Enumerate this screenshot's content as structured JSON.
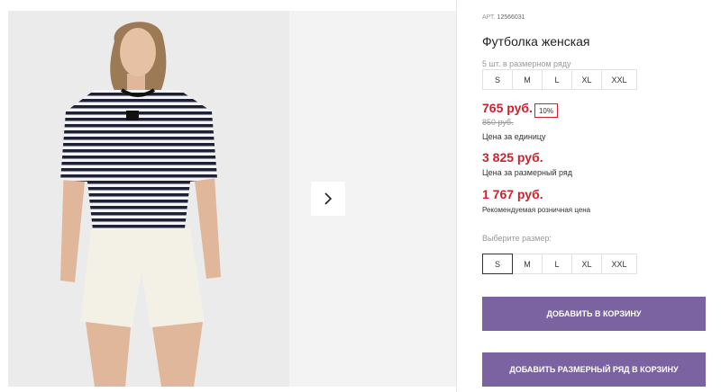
{
  "product": {
    "article_label": "АРТ.",
    "article_code": "12566031",
    "title": "Футболка женская",
    "pack_label": "5 шт. в размерном ряду",
    "pack_sizes": [
      "S",
      "M",
      "L",
      "XL",
      "XXL"
    ],
    "price": "765 руб.",
    "discount": "10%",
    "old_price": "850 руб.",
    "price_per_unit_label": "Цена за единицу",
    "pack_price": "3 825 руб.",
    "pack_price_label": "Цена за размерный ряд",
    "rrp": "1 767 руб.",
    "rrp_label": "Рекомендуемая розничная цена",
    "choose_size_label": "Выберите размер:",
    "size_options": [
      "S",
      "M",
      "L",
      "XL",
      "XXL"
    ],
    "selected_size": "S"
  },
  "buttons": {
    "add_to_cart": "ДОБАВИТЬ В КОРЗИНУ",
    "add_pack_to_cart": "ДОБАВИТЬ РАЗМЕРНЫЙ РЯД В КОРЗИНУ"
  },
  "gallery": {
    "next_icon": "chevron-right-icon"
  },
  "colors": {
    "accent": "#7a63a0",
    "price": "#d21f2a"
  }
}
